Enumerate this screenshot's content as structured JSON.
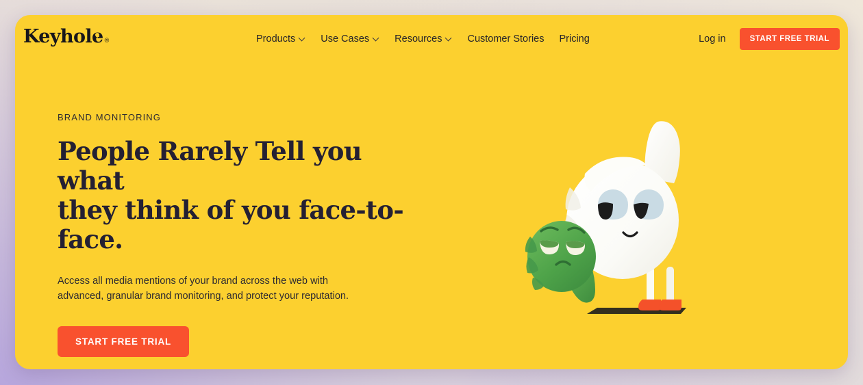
{
  "brand": {
    "name": "Keyhole",
    "trademark": "®",
    "logo_icon": "keyhole-icon"
  },
  "nav": {
    "items": [
      {
        "label": "Products",
        "has_dropdown": true,
        "icon": "chevron-down-icon"
      },
      {
        "label": "Use Cases",
        "has_dropdown": true,
        "icon": "chevron-down-icon"
      },
      {
        "label": "Resources",
        "has_dropdown": true,
        "icon": "chevron-down-icon"
      },
      {
        "label": "Customer Stories",
        "has_dropdown": false,
        "icon": ""
      },
      {
        "label": "Pricing",
        "has_dropdown": false,
        "icon": ""
      }
    ]
  },
  "header_actions": {
    "login_label": "Log in",
    "cta_label": "START FREE TRIAL"
  },
  "hero": {
    "eyebrow": "BRAND MONITORING",
    "headline_line1": "People Rarely Tell you what",
    "headline_line2": "they think of you face-to-face.",
    "subcopy_line1": "Access all media mentions of your brand across the web with",
    "subcopy_line2": "advanced, granular brand monitoring, and protect your reputation.",
    "cta_label": "START FREE TRIAL"
  },
  "illustration": {
    "name": "thumbs-up-down-characters",
    "characters": [
      {
        "name": "thumbs-up-character",
        "color": "#fdfdfb",
        "mood": "happy"
      },
      {
        "name": "thumbs-down-character",
        "color": "#56a84e",
        "mood": "grumpy"
      }
    ],
    "shoe_color": "#f4512a"
  },
  "colors": {
    "hero_background": "#fcd02f",
    "cta": "#f9512e",
    "headline_text": "#242033",
    "page_background_warm": "#ece4d9",
    "page_background_lavender": "#c4b3e0"
  }
}
